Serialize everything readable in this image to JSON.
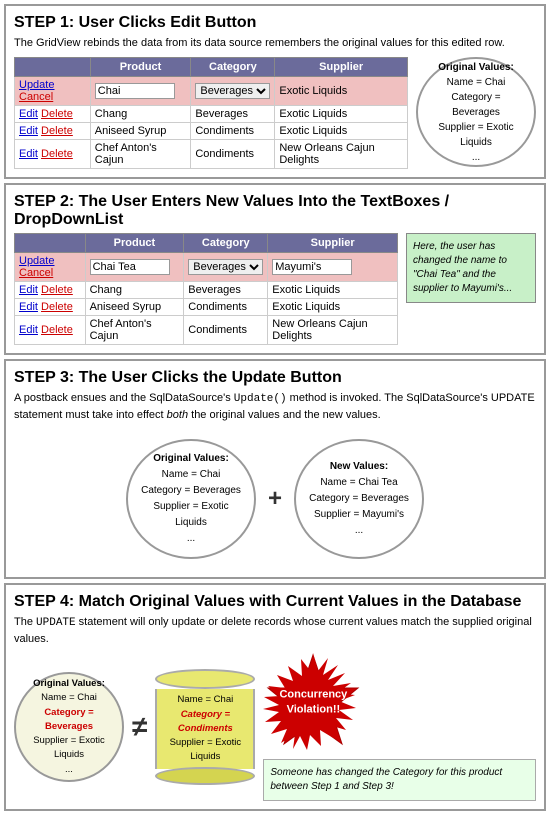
{
  "step1": {
    "title": "STEP 1: User Clicks Edit Button",
    "description": "The GridView rebinds the data from its data source remembers the original values for this edited row.",
    "original_values_circle": {
      "title": "Original Values:",
      "lines": [
        "Name = Chai",
        "Category = Beverages",
        "Supplier = Exotic Liquids",
        "..."
      ]
    },
    "table": {
      "headers": [
        "Product",
        "Category",
        "Supplier"
      ],
      "rows": [
        {
          "actions": "Update Cancel",
          "product": "Chai",
          "category_input": true,
          "category_val": "Beverages",
          "supplier": "Exotic Liquids",
          "highlight": true
        },
        {
          "actions": "Edit Delete",
          "product": "Chang",
          "category": "Beverages",
          "supplier": "Exotic Liquids",
          "highlight": false
        },
        {
          "actions": "Edit Delete",
          "product": "Aniseed Syrup",
          "category": "Condiments",
          "supplier": "Exotic Liquids",
          "highlight": false
        },
        {
          "actions": "Edit Delete",
          "product": "Chef Anton's Cajun",
          "category": "Condiments",
          "supplier": "New Orleans Cajun Delights",
          "highlight": false
        }
      ]
    }
  },
  "step2": {
    "title": "STEP 2: The User Enters New Values Into the TextBoxes / DropDownList",
    "note": "Here, the user has changed the name to \"Chai Tea\" and the supplier to Mayumi's...",
    "table": {
      "headers": [
        "Product",
        "Category",
        "Supplier"
      ],
      "rows": [
        {
          "actions": "Update Cancel",
          "product": "Chai Tea",
          "category_input": true,
          "category_val": "Beverages",
          "supplier_input": true,
          "supplier_val": "Mayumi's",
          "highlight": true
        },
        {
          "actions": "Edit Delete",
          "product": "Chang",
          "category": "Beverages",
          "supplier": "Exotic Liquids",
          "highlight": false
        },
        {
          "actions": "Edit Delete",
          "product": "Aniseed Syrup",
          "category": "Condiments",
          "supplier": "Exotic Liquids",
          "highlight": false
        },
        {
          "actions": "Edit Delete",
          "product": "Chef Anton's Cajun",
          "category": "Condiments",
          "supplier": "New Orleans Cajun Delights",
          "highlight": false
        }
      ]
    }
  },
  "step3": {
    "title": "STEP 3: The User Clicks the Update Button",
    "description": "A postback ensues and the SqlDataSource's Update() method is invoked. The SqlDataSource's UPDATE statement must take into effect both the original values and the new values.",
    "original_circle": {
      "title": "Original Values:",
      "lines": [
        "Name = Chai",
        "Category = Beverages",
        "Supplier = Exotic Liquids",
        "..."
      ]
    },
    "new_circle": {
      "title": "New Values:",
      "lines": [
        "Name = Chai Tea",
        "Category = Beverages",
        "Supplier = Mayumi's",
        "..."
      ]
    },
    "plus": "+"
  },
  "step4": {
    "title": "STEP 4: Match Original Values with Current Values in the Database",
    "description": "The UPDATE statement will only update or delete records whose current values match the supplied original values.",
    "original_circle": {
      "title": "Original Values:",
      "name": "Name = Chai",
      "category": "Category = Beverages",
      "supplier": "Supplier = Exotic Liquids",
      "dots": "..."
    },
    "db_cylinder": {
      "name": "Name = Chai",
      "category": "Category = Condiments",
      "supplier": "Supplier = Exotic Liquids"
    },
    "starburst": {
      "line1": "Concurrency",
      "line2": "Violation!!"
    },
    "note": "Someone has changed the Category for this product between Step 1 and Step 3!"
  }
}
